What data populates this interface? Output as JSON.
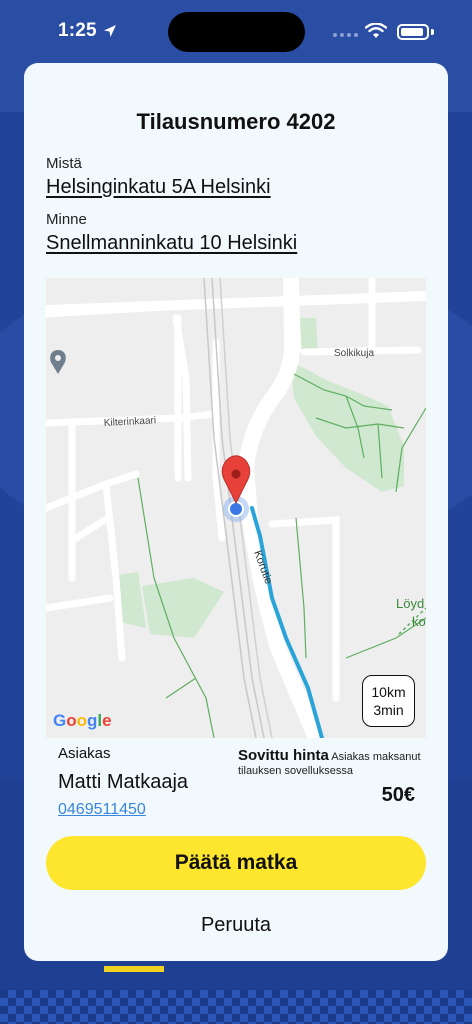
{
  "status_bar": {
    "time": "1:25"
  },
  "order": {
    "title": "Tilausnumero 4202"
  },
  "route": {
    "from_label": "Mistä",
    "from_address": "Helsinginkatu 5A Helsinki",
    "to_label": "Minne",
    "to_address": "Snellmanninkatu 10 Helsinki"
  },
  "map": {
    "streets": [
      "Solkikuja",
      "Kilterinkaari",
      "Korutie"
    ],
    "poi_label": "Löyd\nko",
    "provider": "Google",
    "eta": {
      "distance": "10km",
      "time": "3min"
    },
    "route_color": "#2aa4d8",
    "pin_color": "#e8413a"
  },
  "customer": {
    "label": "Asiakas",
    "name": "Matti Matkaaja",
    "phone": "0469511450"
  },
  "price": {
    "label": "Sovittu hinta",
    "note": "Asiakas maksanut tilauksen sovelluksessa",
    "value": "50€"
  },
  "actions": {
    "end_trip": "Päätä matka",
    "cancel": "Peruuta"
  },
  "colors": {
    "accent": "#fde62d",
    "link": "#3a86d8",
    "background": "#21439a"
  }
}
